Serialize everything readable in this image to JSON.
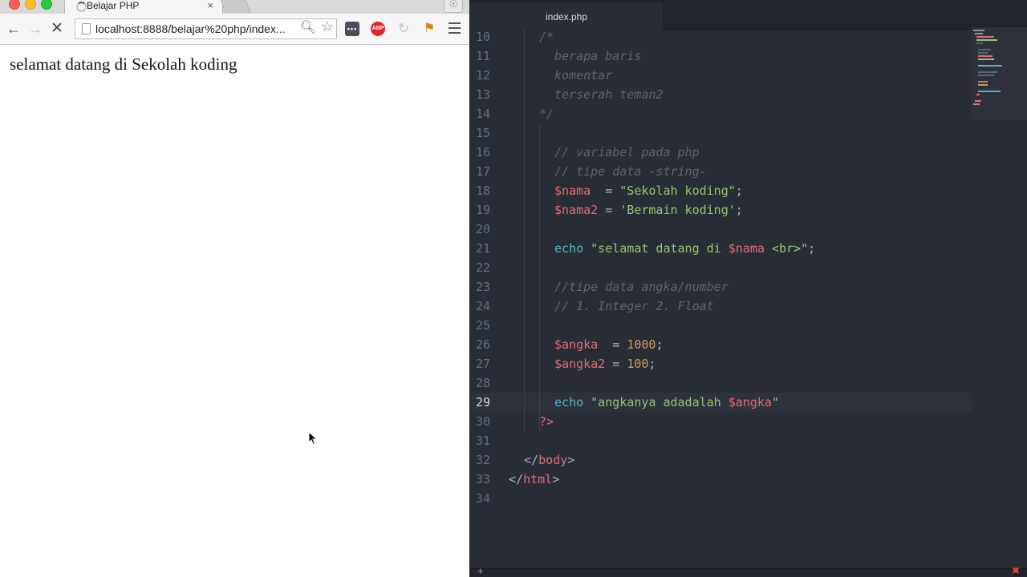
{
  "browser": {
    "tab": {
      "title": "Belajar PHP",
      "close_label": "×"
    },
    "nav": {
      "back": "←",
      "forward": "→",
      "stop": "✕"
    },
    "address": {
      "url": "localhost:8888/belajar%20php/index..."
    },
    "page": {
      "text": "selamat datang di Sekolah koding"
    },
    "icons": {
      "tab_spinner": "loading-spinner-icon",
      "zoom": "zoom-icon",
      "star": "bookmark-star-icon",
      "extension_dots": "extension-dots-icon",
      "abp": "adblock-plus-icon",
      "reload_ext": "reload-extension-icon",
      "flag_ext": "flag-extension-icon",
      "menu": "hamburger-menu-icon",
      "profile": "profile-icon"
    },
    "abp_label": "ABP",
    "ext_dots_label": "•••"
  },
  "editor": {
    "tab_title": "index.php",
    "active_line": 29,
    "lines": [
      {
        "n": "10",
        "tokens": [
          {
            "t": "c",
            "v": "/*"
          }
        ]
      },
      {
        "n": "11",
        "tokens": [
          {
            "t": "c",
            "v": "berapa baris"
          }
        ]
      },
      {
        "n": "12",
        "tokens": [
          {
            "t": "c",
            "v": "komentar"
          }
        ]
      },
      {
        "n": "13",
        "tokens": [
          {
            "t": "c",
            "v": "terserah teman2"
          }
        ]
      },
      {
        "n": "14",
        "tokens": [
          {
            "t": "c",
            "v": "*/"
          }
        ]
      },
      {
        "n": "15",
        "tokens": []
      },
      {
        "n": "16",
        "tokens": [
          {
            "t": "c",
            "v": "// variabel pada php"
          }
        ]
      },
      {
        "n": "17",
        "tokens": [
          {
            "t": "c",
            "v": "// tipe data -string-"
          }
        ]
      },
      {
        "n": "18",
        "tokens": [
          {
            "t": "v",
            "v": "$nama"
          },
          {
            "t": "p",
            "v": "  = "
          },
          {
            "t": "s",
            "v": "\"Sekolah koding\""
          },
          {
            "t": "p",
            "v": ";"
          }
        ]
      },
      {
        "n": "19",
        "tokens": [
          {
            "t": "v",
            "v": "$nama2"
          },
          {
            "t": "p",
            "v": " = "
          },
          {
            "t": "s",
            "v": "'Bermain koding'"
          },
          {
            "t": "p",
            "v": ";"
          }
        ]
      },
      {
        "n": "20",
        "tokens": []
      },
      {
        "n": "21",
        "tokens": [
          {
            "t": "k",
            "v": "echo"
          },
          {
            "t": "p",
            "v": " "
          },
          {
            "t": "s",
            "v": "\"selamat datang di "
          },
          {
            "t": "v",
            "v": "$nama"
          },
          {
            "t": "s",
            "v": " <br>\""
          },
          {
            "t": "p",
            "v": ";"
          }
        ]
      },
      {
        "n": "22",
        "tokens": []
      },
      {
        "n": "23",
        "tokens": [
          {
            "t": "c",
            "v": "//tipe data angka/number"
          }
        ]
      },
      {
        "n": "24",
        "tokens": [
          {
            "t": "c",
            "v": "// 1. Integer 2. Float"
          }
        ]
      },
      {
        "n": "25",
        "tokens": []
      },
      {
        "n": "26",
        "tokens": [
          {
            "t": "v",
            "v": "$angka"
          },
          {
            "t": "p",
            "v": "  = "
          },
          {
            "t": "n",
            "v": "1000"
          },
          {
            "t": "p",
            "v": ";"
          }
        ]
      },
      {
        "n": "27",
        "tokens": [
          {
            "t": "v",
            "v": "$angka2"
          },
          {
            "t": "p",
            "v": " = "
          },
          {
            "t": "n",
            "v": "100"
          },
          {
            "t": "p",
            "v": ";"
          }
        ]
      },
      {
        "n": "28",
        "tokens": []
      },
      {
        "n": "29",
        "tokens": [
          {
            "t": "k",
            "v": "echo"
          },
          {
            "t": "p",
            "v": " "
          },
          {
            "t": "s",
            "v": "\"angkanya adadalah "
          },
          {
            "t": "v",
            "v": "$angka"
          },
          {
            "t": "s",
            "v": "\""
          }
        ]
      },
      {
        "n": "30",
        "tokens": [
          {
            "t": "g",
            "v": "?>"
          }
        ]
      },
      {
        "n": "31",
        "tokens": []
      },
      {
        "n": "32",
        "tokens": [
          {
            "t": "p",
            "v": "</"
          },
          {
            "t": "g",
            "v": "body"
          },
          {
            "t": "p",
            "v": ">"
          }
        ]
      },
      {
        "n": "33",
        "tokens": [
          {
            "t": "p",
            "v": "</"
          },
          {
            "t": "g",
            "v": "html"
          },
          {
            "t": "p",
            "v": ">"
          }
        ]
      },
      {
        "n": "34",
        "tokens": []
      }
    ],
    "status": {
      "add_label": "+",
      "error_label": "✖"
    }
  },
  "colors": {
    "comment": "#5c6370",
    "variable": "#e06c75",
    "string": "#98c379",
    "number": "#d19a66",
    "keyword": "#56b6c2",
    "editor_bg": "#282c34"
  }
}
